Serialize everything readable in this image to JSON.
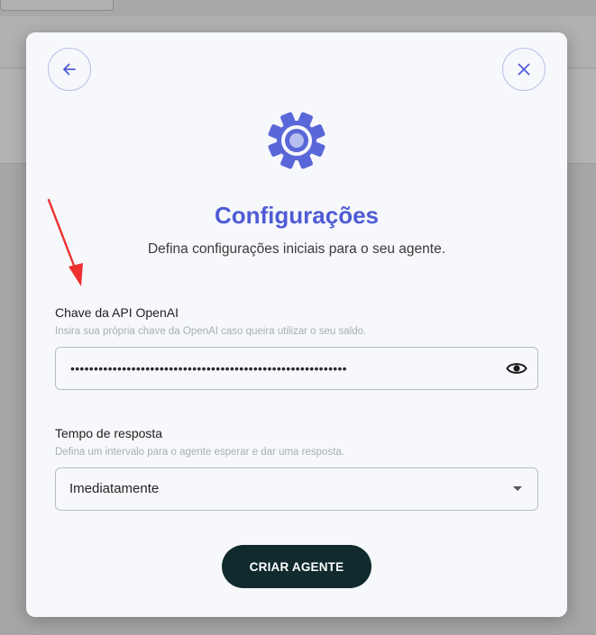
{
  "modal": {
    "title": "Configurações",
    "subtitle": "Defina configurações iniciais para o seu agente."
  },
  "api_key": {
    "label": "Chave da API OpenAI",
    "helper": "Insira sua própria chave da OpenAI caso queira utilizar o seu saldo.",
    "value": "•••••••••••••••••••••••••••••••••••••••••••••••••••••••••••"
  },
  "response_time": {
    "label": "Tempo de resposta",
    "helper": "Defina um intervalo para o agente esperar e dar uma resposta.",
    "selected": "Imediatamente"
  },
  "submit_label": "CRIAR AGENTE",
  "colors": {
    "accent": "#4f5bd5",
    "gear": "#5a67d8",
    "button_bg": "#102a2d",
    "annotation_arrow": "#ee3030"
  }
}
